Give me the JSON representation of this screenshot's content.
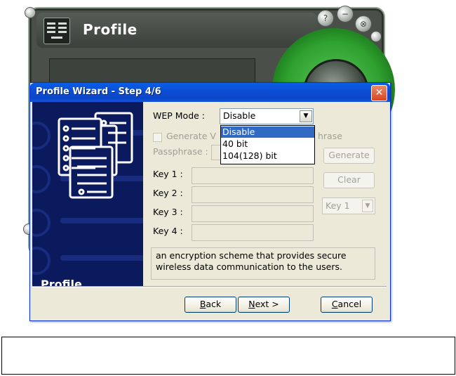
{
  "app": {
    "title": "Profile",
    "window_buttons": [
      "?",
      "⊗"
    ]
  },
  "dialog": {
    "title": "Profile Wizard - Step 4/6",
    "side_label": "Profile",
    "wep_mode_label": "WEP Mode :",
    "wep_mode_value": "Disable",
    "wep_mode_options": [
      {
        "label": "Disable",
        "selected": true
      },
      {
        "label": "40 bit",
        "selected": false
      },
      {
        "label": "104(128) bit",
        "selected": false
      }
    ],
    "generate_checkbox_label_pre": "Generate V",
    "generate_checkbox_label_post": "hrase",
    "passphrase_label": "Passphrase :",
    "generate_button": "Generate",
    "clear_button": "Clear",
    "default_key_value": "Key 1",
    "keys": [
      {
        "label": "Key 1 :",
        "value": ""
      },
      {
        "label": "Key 2 :",
        "value": ""
      },
      {
        "label": "Key 3 :",
        "value": ""
      },
      {
        "label": "Key 4 :",
        "value": ""
      }
    ],
    "description": "an encryption scheme that provides secure wireless data communication to the users.",
    "back_button": {
      "mnemonic": "B",
      "rest": "ack"
    },
    "next_button": {
      "mnemonic": "N",
      "rest": "ext >"
    },
    "cancel_button": {
      "mnemonic": "C",
      "rest": "ancel"
    }
  },
  "colors": {
    "titlebar": "#0b4fd6",
    "side_panel": "#0a1a5c",
    "selection": "#316ac5",
    "disc_green": "#2ea12e"
  }
}
